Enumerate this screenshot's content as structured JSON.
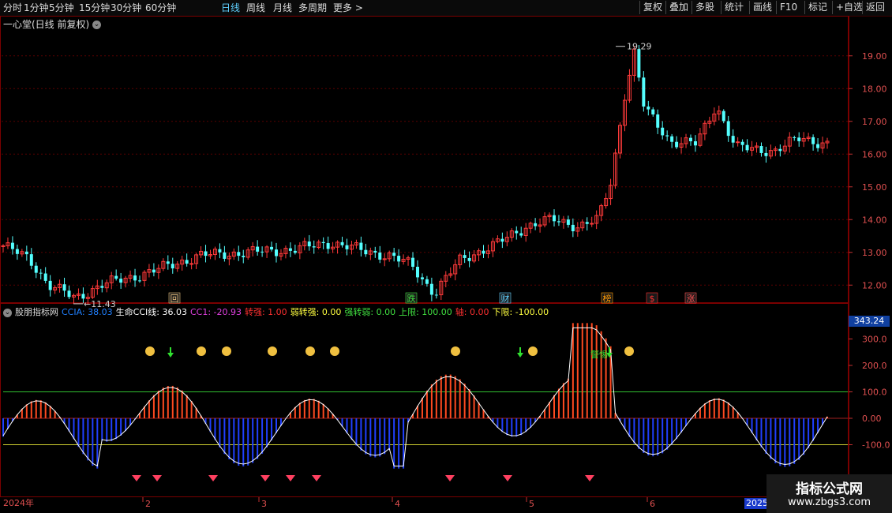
{
  "toolbar": {
    "periods": [
      "分时",
      "1分钟",
      "5分钟",
      "15分钟",
      "30分钟",
      "60分钟",
      "日线",
      "周线",
      "月线",
      "多周期",
      "更多 >"
    ],
    "active_period": "日线",
    "right_buttons": [
      "复权",
      "叠加",
      "多股",
      "统计",
      "画线",
      "F10",
      "标记",
      "+自选",
      "返回"
    ]
  },
  "main": {
    "title": "一心堂(日线 前复权)",
    "high_label": "19.29",
    "low_label": "11.43",
    "price_ticks": [
      "19.00",
      "18.00",
      "17.00",
      "16.00",
      "15.00",
      "14.00",
      "13.00",
      "12.00"
    ],
    "event_labels": [
      {
        "text": "回",
        "color": "#e8c080"
      },
      {
        "text": "跌",
        "color": "#40e040"
      },
      {
        "text": "财",
        "color": "#5fd0ff"
      },
      {
        "text": "榜",
        "color": "#ff9900"
      },
      {
        "text": "$",
        "color": "#ff3030"
      },
      {
        "text": "涨",
        "color": "#ff5050"
      }
    ]
  },
  "indicator": {
    "name": "股朋指标网",
    "items": [
      {
        "label": "CCIA:",
        "value": "38.03",
        "color": "#2080ff"
      },
      {
        "label": "生命CCI线:",
        "value": "36.03",
        "color": "#ffffff"
      },
      {
        "label": "CC1:",
        "value": "-20.93",
        "color": "#e040e0"
      },
      {
        "label": "转强:",
        "value": "1.00",
        "color": "#ff3030"
      },
      {
        "label": "弱转强:",
        "value": "0.00",
        "color": "#ffff40"
      },
      {
        "label": "强转弱:",
        "value": "0.00",
        "color": "#40e040"
      },
      {
        "label": "上限:",
        "value": "100.00",
        "color": "#40e040"
      },
      {
        "label": "轴:",
        "value": "0.00",
        "color": "#ff3030"
      },
      {
        "label": "下限:",
        "value": "-100.00",
        "color": "#ffff40"
      }
    ],
    "ticks": [
      "300.0",
      "200.0",
      "100.0",
      "0.00",
      "-100.0"
    ],
    "current_value": "343.24",
    "annotation_text": "警惕"
  },
  "dates": {
    "year_start": "2024年",
    "months": [
      "2",
      "3",
      "4",
      "5",
      "6"
    ],
    "year_next": "2025"
  },
  "watermark": {
    "title": "指标公式网",
    "url": "www.zbgs3.com"
  },
  "chart_data": {
    "type": "candlestick+histogram",
    "price_axis": [
      11.5,
      19.5
    ],
    "indicator_axis": [
      -200,
      350
    ],
    "indicator_upper": 100,
    "indicator_lower": -100,
    "high": 19.29,
    "low": 11.43
  }
}
